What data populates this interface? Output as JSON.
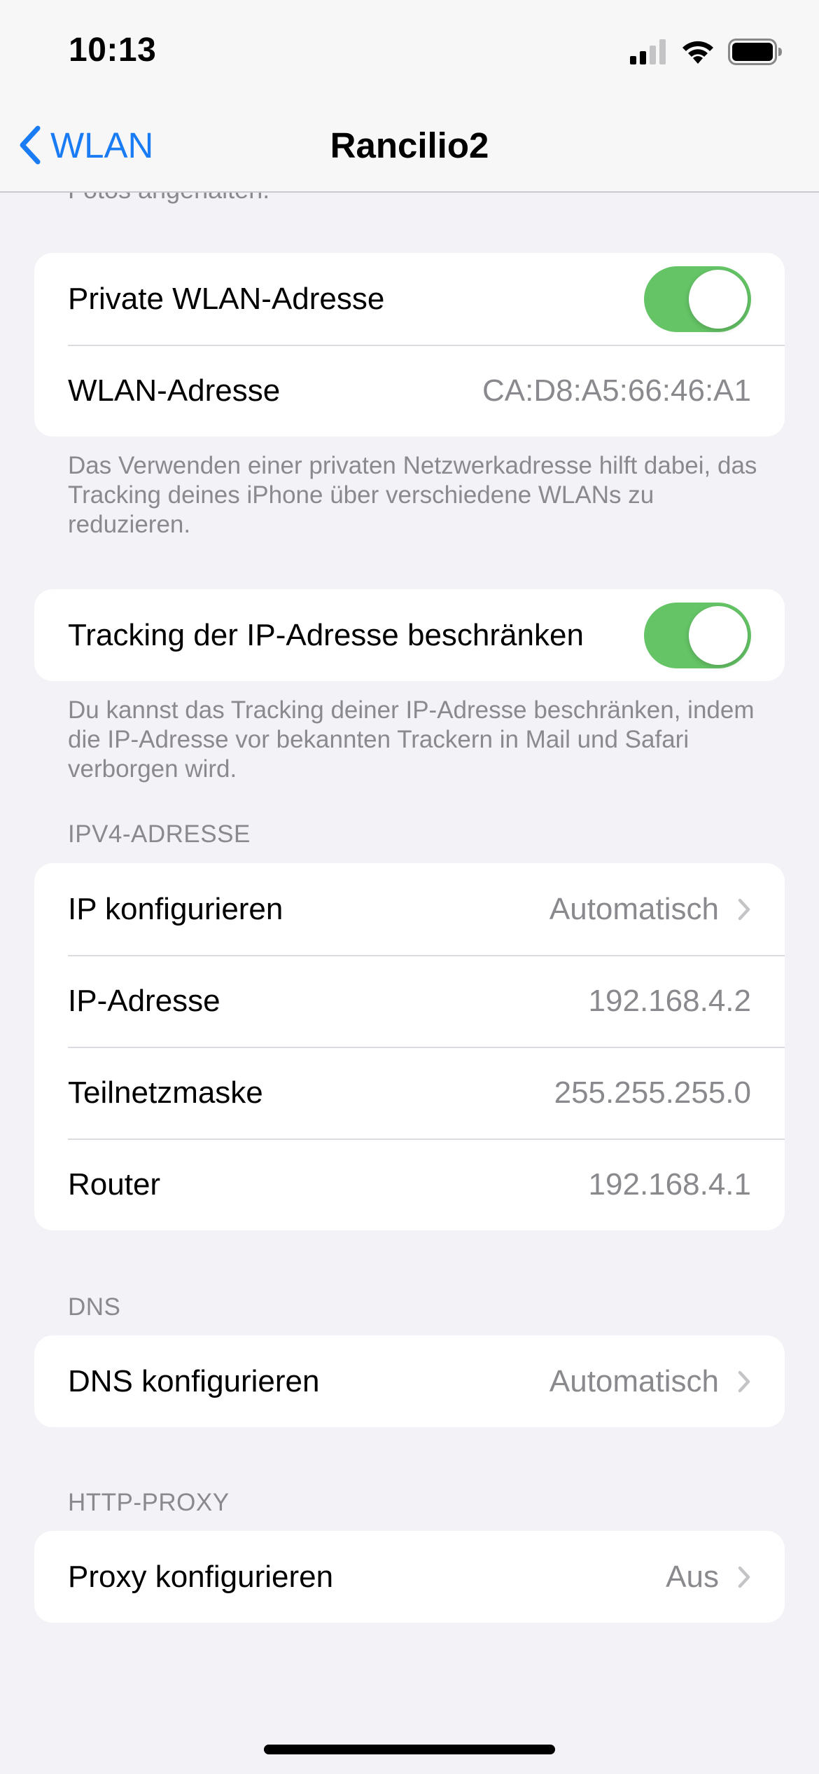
{
  "status_bar": {
    "time": "10:13",
    "icons": [
      "cellular-signal-icon",
      "wifi-icon",
      "battery-icon"
    ]
  },
  "nav": {
    "back_label": "WLAN",
    "title": "Rancilio2",
    "accent_color": "#1a7cf5"
  },
  "scrolled_footer": "Fotos angehalten.",
  "private_address_section": {
    "private_toggle_label": "Private WLAN-Adresse",
    "private_toggle_on": true,
    "wlan_address_label": "WLAN-Adresse",
    "wlan_address_value": "CA:D8:A5:66:46:A1",
    "footer": "Das Verwenden einer privaten Netzwerkadresse hilft dabei, das Tracking deines iPhone über verschiedene WLANs zu reduzieren."
  },
  "tracking_section": {
    "toggle_label": "Tracking der IP-Adresse beschränken",
    "toggle_on": true,
    "footer": "Du kannst das Tracking deiner IP-Adresse beschränken, indem die IP-Adresse vor bekannten Trackern in Mail und Safari verborgen wird."
  },
  "ipv4_section": {
    "header": "IPV4-ADRESSE",
    "configure_label": "IP konfigurieren",
    "configure_value": "Automatisch",
    "ip_label": "IP-Adresse",
    "ip_value": "192.168.4.2",
    "subnet_label": "Teilnetzmaske",
    "subnet_value": "255.255.255.0",
    "router_label": "Router",
    "router_value": "192.168.4.1"
  },
  "dns_section": {
    "header": "DNS",
    "configure_label": "DNS konfigurieren",
    "configure_value": "Automatisch"
  },
  "proxy_section": {
    "header": "HTTP-PROXY",
    "configure_label": "Proxy konfigurieren",
    "configure_value": "Aus"
  },
  "colors": {
    "toggle_on": "#65c466",
    "background": "#f2f2f7",
    "secondary_text": "#8a8a8e"
  }
}
